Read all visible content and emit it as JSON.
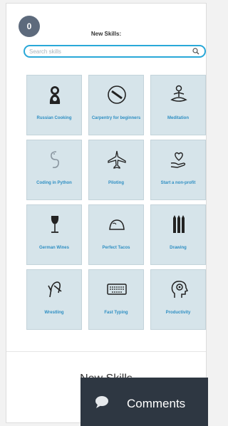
{
  "header": {
    "badge_count": "0",
    "title": "New Skills:"
  },
  "search": {
    "placeholder": "Search skills"
  },
  "skills": [
    {
      "label": "Russian Cooking",
      "icon": "matryoshka-icon"
    },
    {
      "label": "Carpentry for beginners",
      "icon": "saw-icon"
    },
    {
      "label": "Meditation",
      "icon": "meditation-icon"
    },
    {
      "label": "Coding in Python",
      "icon": "python-icon"
    },
    {
      "label": "Piloting",
      "icon": "airplane-icon"
    },
    {
      "label": "Start a non-profit",
      "icon": "heart-hand-icon"
    },
    {
      "label": "German Wines",
      "icon": "wine-glass-icon"
    },
    {
      "label": "Perfect Tacos",
      "icon": "taco-icon"
    },
    {
      "label": "Drawing",
      "icon": "pencils-icon"
    },
    {
      "label": "Wrestling",
      "icon": "wrestling-icon"
    },
    {
      "label": "Fast Typing",
      "icon": "keyboard-icon"
    },
    {
      "label": "Productivity",
      "icon": "head-gear-icon"
    }
  ],
  "footer": {
    "title": "New Skills"
  },
  "comments": {
    "label": "Comments"
  },
  "colors": {
    "accent": "#29a8d8",
    "label": "#2f8fc3",
    "tile": "#d6e4ea",
    "badge": "#5d6a7c",
    "comments_bg": "#2e3742"
  }
}
